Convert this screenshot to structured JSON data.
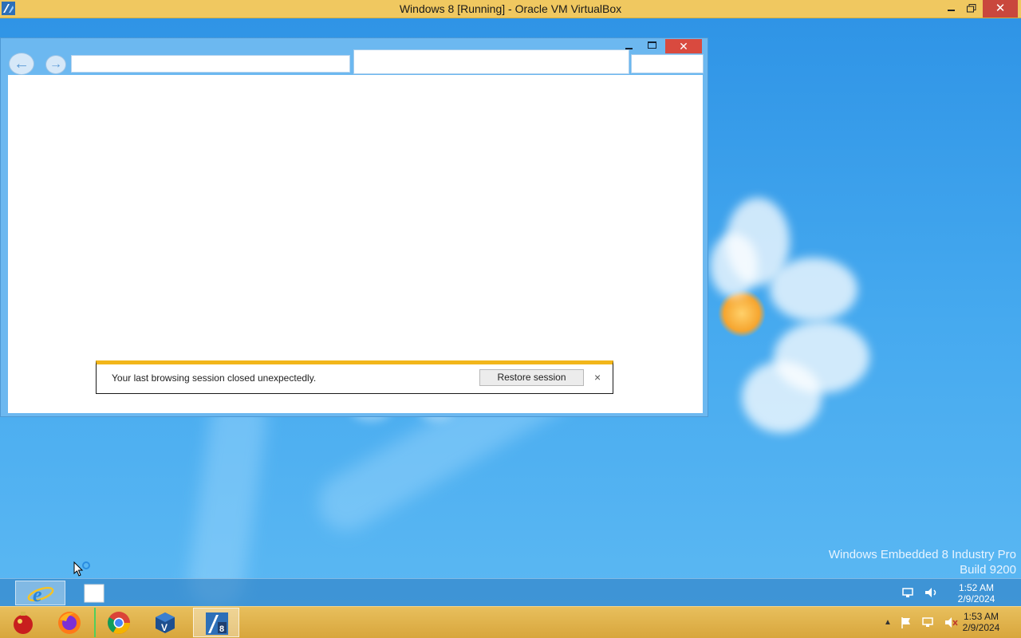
{
  "host": {
    "title": "Windows 8 [Running] - Oracle VM VirtualBox",
    "controls": {
      "minimize": "minimize",
      "restore": "restore",
      "close": "✕"
    },
    "taskbar": {
      "items": [
        {
          "name": "app-ornament",
          "icon": "ornament-icon"
        },
        {
          "name": "firefox",
          "icon": "firefox-icon"
        },
        {
          "name": "chrome",
          "icon": "chrome-icon"
        },
        {
          "name": "virtualbox",
          "icon": "virtualbox-icon"
        },
        {
          "name": "windows8-vm",
          "icon": "windows8-vm-icon",
          "active": true
        }
      ],
      "clock": {
        "time": "1:53 AM",
        "date": "2/9/2024"
      }
    }
  },
  "guest": {
    "watermark": {
      "line1": "Windows Embedded 8 Industry Pro",
      "line2": "Build 9200"
    },
    "ie": {
      "close_label": "✕",
      "back": "←",
      "forward": "→",
      "notification": {
        "message": "Your last browsing session closed unexpectedly.",
        "button": "Restore session",
        "close": "×"
      }
    },
    "taskbar": {
      "clock": {
        "time": "1:52 AM",
        "date": "2/9/2024"
      }
    }
  },
  "colors": {
    "host_bar": "#f0c860",
    "ie_frame": "#6cb8f0",
    "notify_accent": "#f2b61b",
    "close_red": "#d94a3f"
  }
}
